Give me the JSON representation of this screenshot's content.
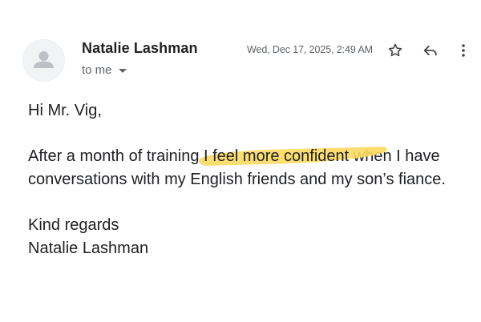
{
  "email": {
    "sender_name": "Natalie Lashman",
    "recipient_label": "to me",
    "date": "Wed, Dec 17, 2025, 2:49 AM",
    "actions": {
      "star_icon": "star-outline",
      "reply_icon": "reply-arrow",
      "more_icon": "more-vertical"
    },
    "body": {
      "greeting": "Hi Mr. Vig,",
      "para1_before": "After a month of training ",
      "para1_highlight": "I feel more confident",
      "para1_after": " when I have conversations with my English friends and my son’s fiance.",
      "signoff": "Kind regards",
      "signature": "Natalie Lashman"
    }
  },
  "colors": {
    "highlight": "#fbd961",
    "text": "#202124",
    "secondary_text": "#5f6368"
  }
}
